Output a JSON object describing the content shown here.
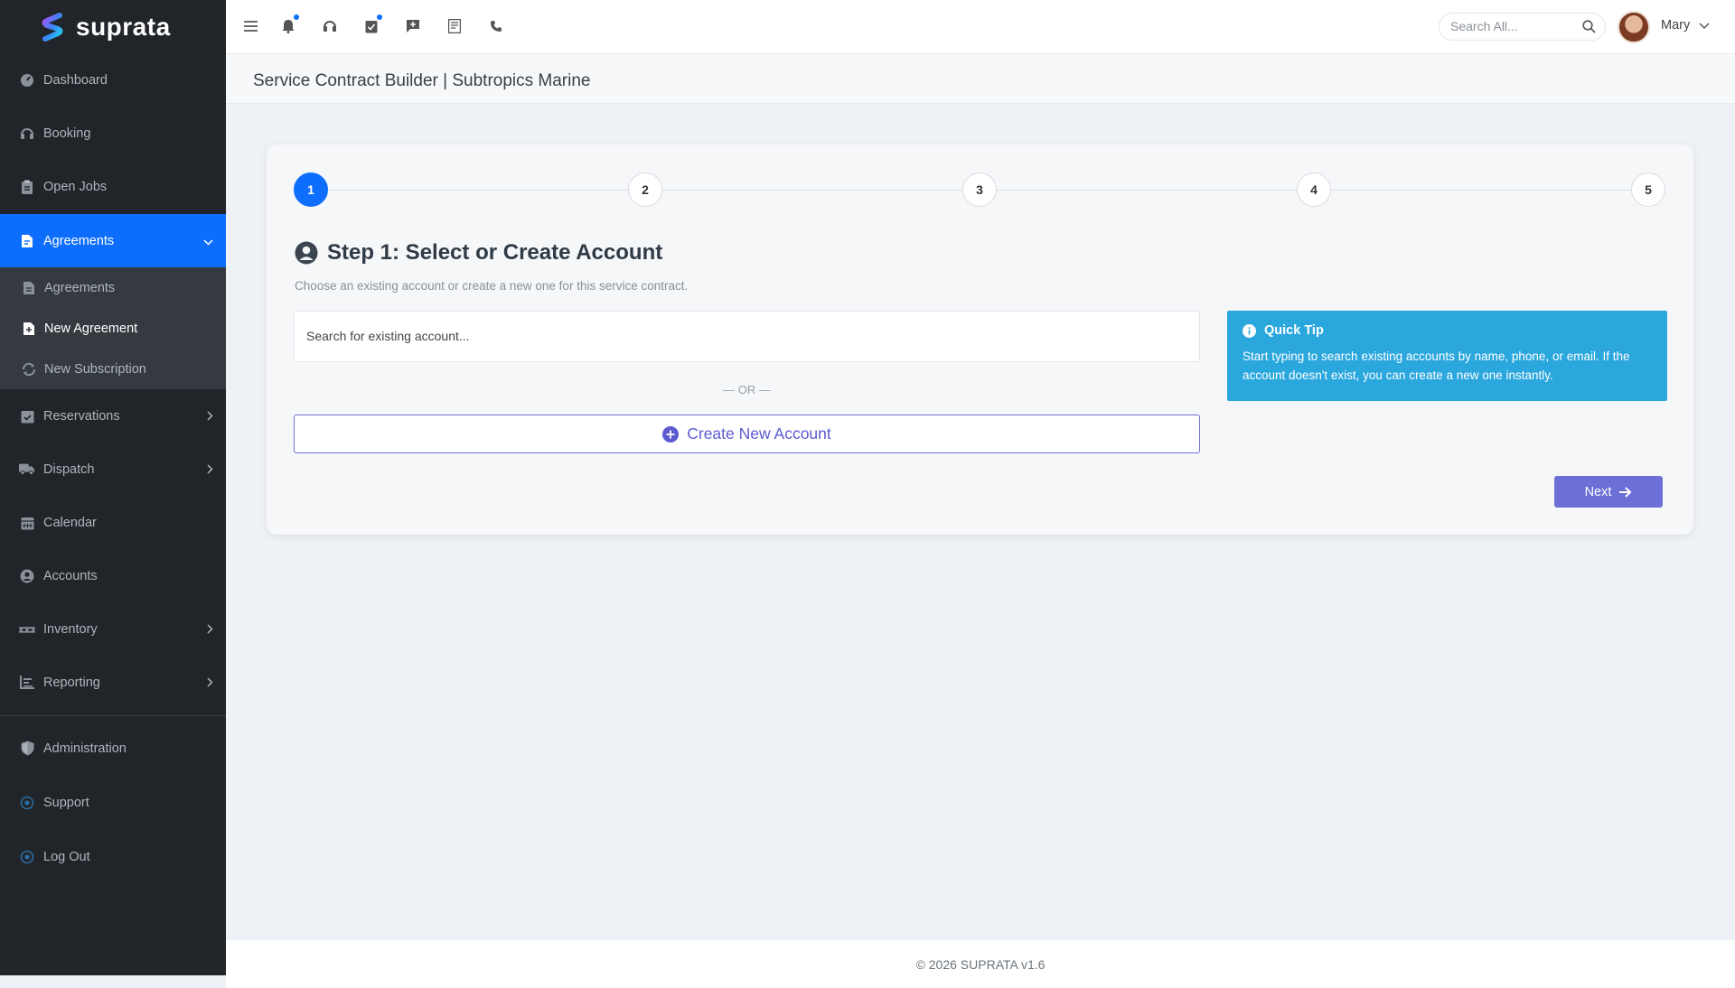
{
  "brand": {
    "name": "suprata",
    "logo_icon": "suprata-logo"
  },
  "sidebar": {
    "items": [
      {
        "key": "dashboard",
        "label": "Dashboard",
        "icon": "gauge-icon"
      },
      {
        "key": "booking",
        "label": "Booking",
        "icon": "headset-icon"
      },
      {
        "key": "open_jobs",
        "label": "Open Jobs",
        "icon": "clipboard-icon"
      },
      {
        "key": "agreements",
        "label": "Agreements",
        "icon": "file-contract-icon",
        "active": true,
        "expanded": true
      },
      {
        "key": "reservations",
        "label": "Reservations",
        "icon": "calendar-check-icon"
      },
      {
        "key": "dispatch",
        "label": "Dispatch",
        "icon": "truck-icon"
      },
      {
        "key": "calendar",
        "label": "Calendar",
        "icon": "calendar-icon"
      },
      {
        "key": "accounts",
        "label": "Accounts",
        "icon": "user-circle-icon"
      },
      {
        "key": "inventory",
        "label": "Inventory",
        "icon": "pallet-icon"
      },
      {
        "key": "reporting",
        "label": "Reporting",
        "icon": "chart-icon"
      },
      {
        "key": "administration",
        "label": "Administration",
        "icon": "shield-icon"
      },
      {
        "key": "support",
        "label": "Support",
        "icon": "support-icon"
      },
      {
        "key": "logout",
        "label": "Log Out",
        "icon": "logout-icon"
      }
    ],
    "sub_items": [
      {
        "label": "Agreements",
        "icon": "file-icon"
      },
      {
        "label": "New Agreement",
        "icon": "file-plus-icon",
        "current": true
      },
      {
        "label": "New Subscription",
        "icon": "sync-icon"
      }
    ]
  },
  "topbar": {
    "icons": [
      "menu-icon",
      "bell-icon",
      "headset-icon",
      "tasks-icon",
      "comment-plus-icon",
      "invoice-icon",
      "phone-icon"
    ],
    "search_placeholder": "Search All...",
    "user_name": "Mary"
  },
  "page": {
    "title": "Service Contract Builder | Subtropics Marine"
  },
  "wizard": {
    "steps": [
      "1",
      "2",
      "3",
      "4",
      "5"
    ],
    "active_step": 1,
    "heading": "Step 1: Select or Create Account",
    "description": "Choose an existing account or create a new one for this service contract.",
    "search_placeholder": "Search for existing account...",
    "or_label": "— OR —",
    "create_label": "Create New Account",
    "tip_title": "Quick Tip",
    "tip_text": "Start typing to search existing accounts by name, phone, or email. If the account doesn't exist, you can create a new one instantly.",
    "next_label": "Next"
  },
  "footer": {
    "text": "© 2026 SUPRATA v1.6"
  },
  "colors": {
    "sidebar_bg": "#212529",
    "accent": "#0d6efd",
    "button": "#6c6fd6",
    "tip_bg": "#2aa7dd"
  }
}
